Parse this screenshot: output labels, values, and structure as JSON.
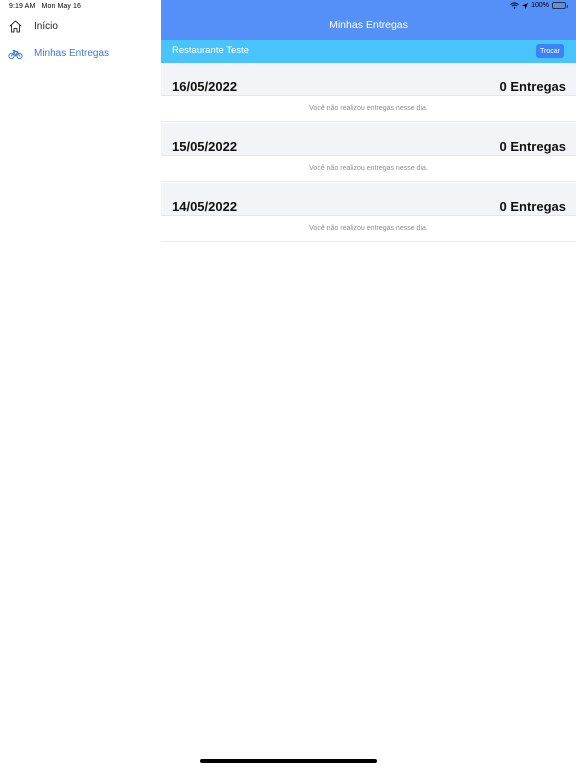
{
  "status_bar": {
    "time": "9:19 AM",
    "date": "Mon May 16",
    "battery": "100%",
    "icons": [
      "wifi-icon",
      "location-arrow-icon",
      "battery-icon"
    ]
  },
  "sidebar": {
    "items": [
      {
        "label": "Início",
        "icon": "home-icon",
        "active": false
      },
      {
        "label": "Minhas Entregas",
        "icon": "bicycle-icon",
        "active": true
      }
    ]
  },
  "header": {
    "title": "Minhas Entregas"
  },
  "restaurant_bar": {
    "name": "Restaurante Teste",
    "button_label": "Trocar"
  },
  "days": [
    {
      "date": "16/05/2022",
      "count": "0 Entregas",
      "message": "Você não realizou entregas nesse dia."
    },
    {
      "date": "15/05/2022",
      "count": "0 Entregas",
      "message": "Você não realizou entregas nesse dia."
    },
    {
      "date": "14/05/2022",
      "count": "0 Entregas",
      "message": "Você não realizou entregas nesse dia."
    }
  ],
  "colors": {
    "header_bg": "#5590f8",
    "restaurant_bar_bg": "#49c3fb",
    "button_bg": "#3b82f6",
    "active_nav": "#3a7bd5",
    "day_header_bg": "#f3f4f7"
  }
}
